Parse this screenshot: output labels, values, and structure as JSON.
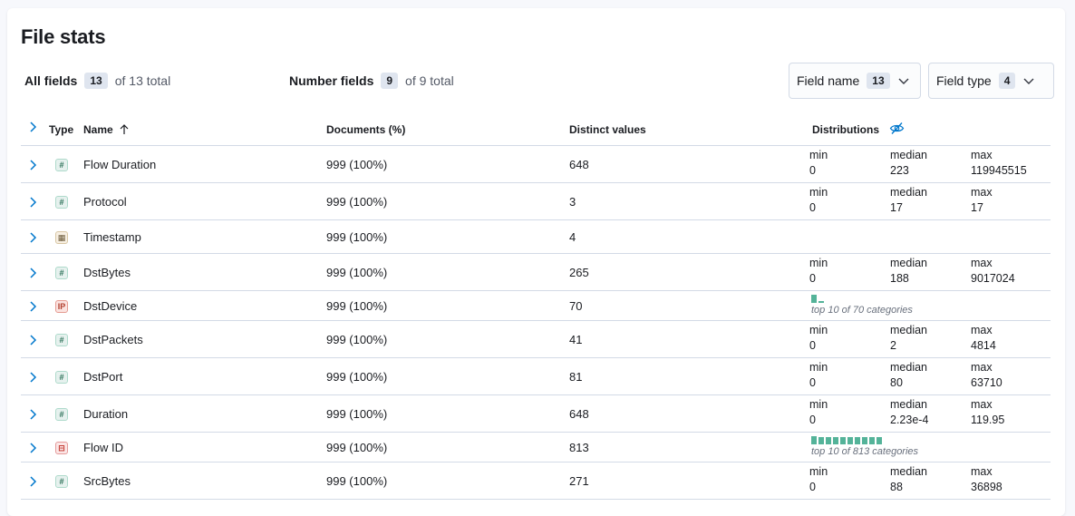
{
  "title": "File stats",
  "all_fields": {
    "label": "All fields",
    "count": "13",
    "suffix": "of 13 total"
  },
  "number_fields": {
    "label": "Number fields",
    "count": "9",
    "suffix": "of 9 total"
  },
  "filters": [
    {
      "label": "Field name",
      "count": "13"
    },
    {
      "label": "Field type",
      "count": "4"
    }
  ],
  "headers": {
    "type": "Type",
    "name": "Name",
    "documents": "Documents (%)",
    "distinct": "Distinct values",
    "distributions": "Distributions"
  },
  "stat_labels": {
    "min": "min",
    "median": "median",
    "max": "max"
  },
  "colors": {
    "accent": "#0077cc",
    "bar": "#54b399"
  },
  "rows": [
    {
      "type": "number",
      "name": "Flow Duration",
      "docs": "999 (100%)",
      "distinct": "648",
      "min": "0",
      "median": "223",
      "max": "119945515"
    },
    {
      "type": "number",
      "name": "Protocol",
      "docs": "999 (100%)",
      "distinct": "3",
      "min": "0",
      "median": "17",
      "max": "17"
    },
    {
      "type": "date",
      "name": "Timestamp",
      "docs": "999 (100%)",
      "distinct": "4"
    },
    {
      "type": "number",
      "name": "DstBytes",
      "docs": "999 (100%)",
      "distinct": "265",
      "min": "0",
      "median": "188",
      "max": "9017024"
    },
    {
      "type": "ip",
      "name": "DstDevice",
      "docs": "999 (100%)",
      "distinct": "70",
      "categories": "top 10 of 70 categories",
      "bar_values": [
        1.0,
        0.2
      ]
    },
    {
      "type": "number",
      "name": "DstPackets",
      "docs": "999 (100%)",
      "distinct": "41",
      "min": "0",
      "median": "2",
      "max": "4814"
    },
    {
      "type": "number",
      "name": "DstPort",
      "docs": "999 (100%)",
      "distinct": "81",
      "min": "0",
      "median": "80",
      "max": "63710"
    },
    {
      "type": "number",
      "name": "Duration",
      "docs": "999 (100%)",
      "distinct": "648",
      "min": "0",
      "median": "2.23e-4",
      "max": "119.95"
    },
    {
      "type": "keyword",
      "name": "Flow ID",
      "docs": "999 (100%)",
      "distinct": "813",
      "categories": "top 10 of 813 categories",
      "bar_values": [
        1.0,
        0.9,
        0.9,
        0.9,
        0.9,
        0.9,
        0.9,
        0.9,
        0.9,
        0.9
      ]
    },
    {
      "type": "number",
      "name": "SrcBytes",
      "docs": "999 (100%)",
      "distinct": "271",
      "min": "0",
      "median": "88",
      "max": "36898"
    }
  ]
}
